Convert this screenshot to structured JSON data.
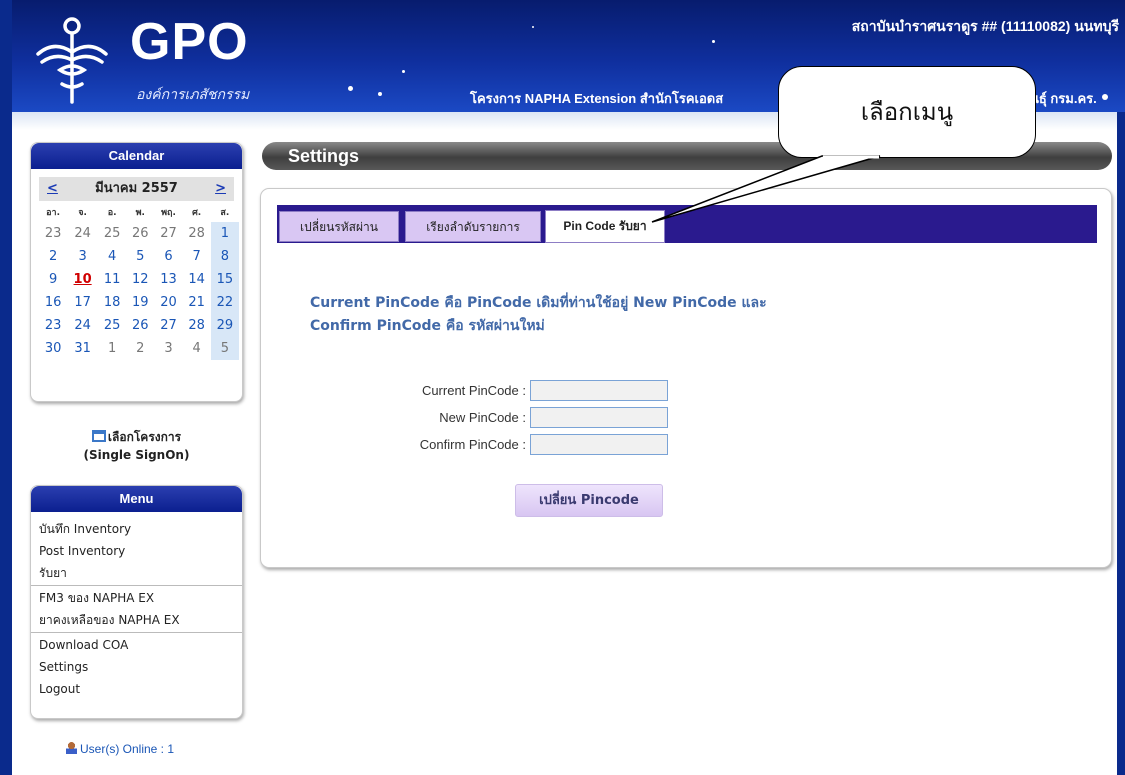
{
  "header": {
    "logo_text": "GPO",
    "logo_subtitle": "องค์การเภสัชกรรม",
    "hospital": "สถาบันบำราศนราดูร ## (11110082) นนทบุรี",
    "project_left": "โครงการ NAPHA Extension สำนักโรคเอดส",
    "project_right": "นธุ์ กรม.คร.",
    "colors": {
      "band": "#0f2f9e",
      "band_dark": "#071c6e"
    }
  },
  "callout": {
    "text": "เลือกเมนู"
  },
  "calendar": {
    "title": "Calendar",
    "month": "มีนาคม 2557",
    "prev": "<",
    "next": ">",
    "weekdays": [
      "อา.",
      "จ.",
      "อ.",
      "พ.",
      "พฤ.",
      "ศ.",
      "ส."
    ],
    "weeks": [
      [
        {
          "d": "23",
          "muted": true
        },
        {
          "d": "24",
          "muted": true
        },
        {
          "d": "25",
          "muted": true
        },
        {
          "d": "26",
          "muted": true
        },
        {
          "d": "27",
          "muted": true
        },
        {
          "d": "28",
          "muted": true
        },
        {
          "d": "1"
        }
      ],
      [
        {
          "d": "2"
        },
        {
          "d": "3"
        },
        {
          "d": "4"
        },
        {
          "d": "5"
        },
        {
          "d": "6"
        },
        {
          "d": "7"
        },
        {
          "d": "8"
        }
      ],
      [
        {
          "d": "9"
        },
        {
          "d": "10",
          "today": true
        },
        {
          "d": "11"
        },
        {
          "d": "12"
        },
        {
          "d": "13"
        },
        {
          "d": "14"
        },
        {
          "d": "15"
        }
      ],
      [
        {
          "d": "16"
        },
        {
          "d": "17"
        },
        {
          "d": "18"
        },
        {
          "d": "19"
        },
        {
          "d": "20"
        },
        {
          "d": "21"
        },
        {
          "d": "22"
        }
      ],
      [
        {
          "d": "23"
        },
        {
          "d": "24"
        },
        {
          "d": "25"
        },
        {
          "d": "26"
        },
        {
          "d": "27"
        },
        {
          "d": "28"
        },
        {
          "d": "29"
        }
      ],
      [
        {
          "d": "30"
        },
        {
          "d": "31"
        },
        {
          "d": "1",
          "muted": true
        },
        {
          "d": "2",
          "muted": true
        },
        {
          "d": "3",
          "muted": true
        },
        {
          "d": "4",
          "muted": true
        },
        {
          "d": "5",
          "muted": true
        }
      ]
    ]
  },
  "single_signon": {
    "line1": "เลือกโครงการ",
    "line2": "(Single SignOn)"
  },
  "menu": {
    "title": "Menu",
    "groups": [
      [
        "บันทึก Inventory",
        "Post Inventory",
        "รับยา"
      ],
      [
        "FM3 ของ NAPHA EX",
        "ยาคงเหลือของ NAPHA EX"
      ],
      [
        "Download COA",
        "Settings",
        "Logout"
      ]
    ]
  },
  "online": {
    "label": "User(s) Online : 1"
  },
  "settings": {
    "title": "Settings",
    "tabs": [
      {
        "label": "เปลี่ยนรหัสผ่าน",
        "active": false
      },
      {
        "label": "เรียงลำดับรายการ",
        "active": false
      },
      {
        "label": "Pin Code รับยา",
        "active": true
      }
    ],
    "info_line1": "Current PinCode คือ PinCode เดิมที่ท่านใช้อยู่ New PinCode และ",
    "info_line2": "Confirm PinCode คือ รหัสผ่านใหม่",
    "fields": {
      "current": "Current PinCode :",
      "new": "New PinCode :",
      "confirm": "Confirm PinCode :"
    },
    "button": "เปลี่ยน Pincode"
  }
}
